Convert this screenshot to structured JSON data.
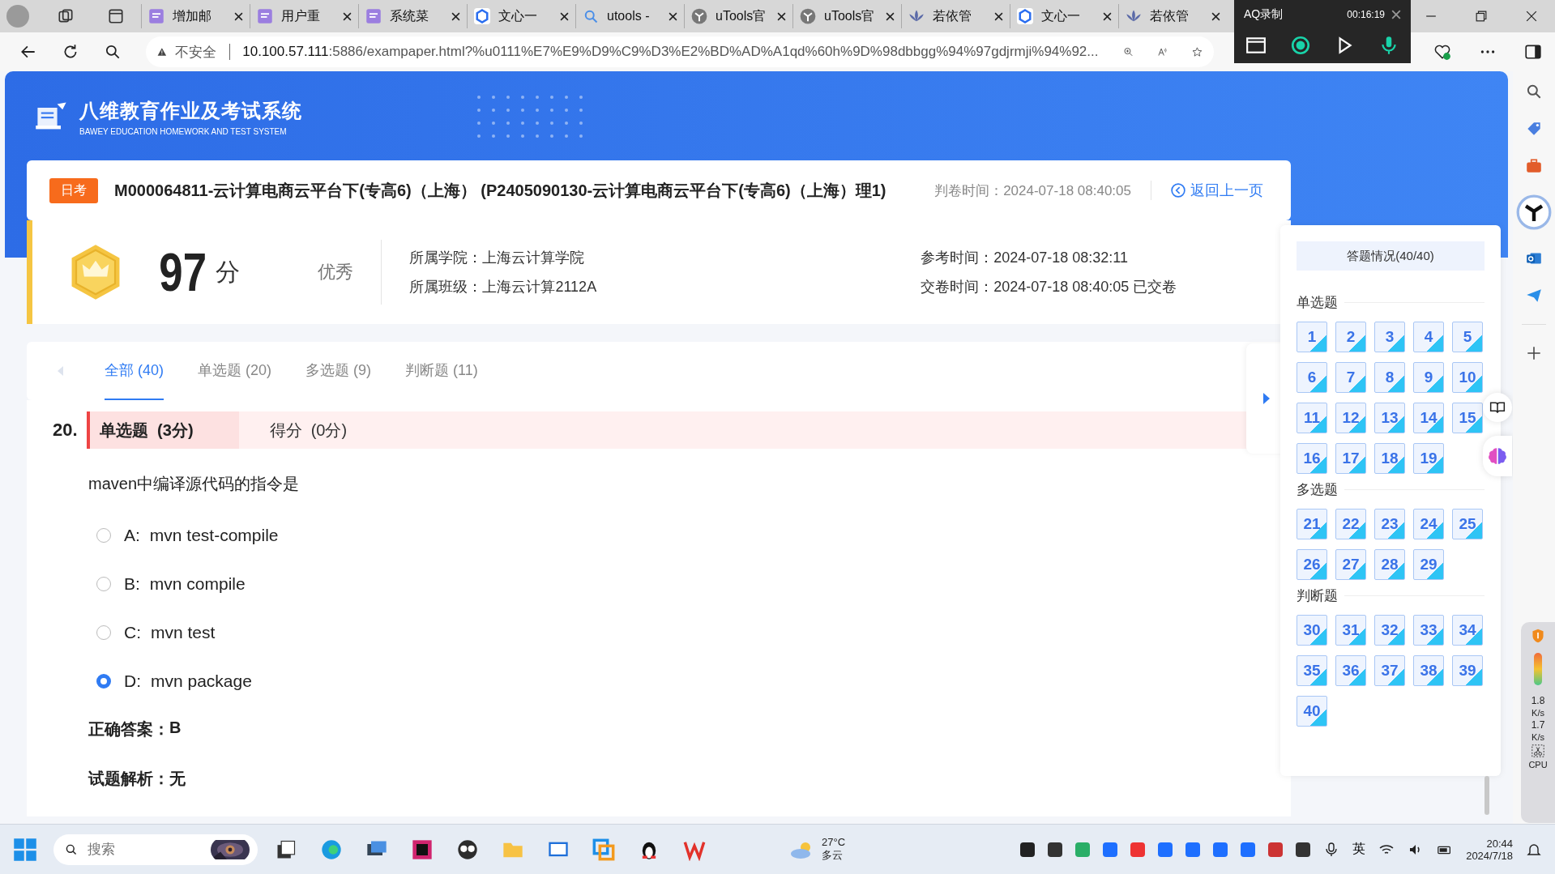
{
  "browser": {
    "tabs": [
      {
        "kind": "doc",
        "title": "增加邮"
      },
      {
        "kind": "doc",
        "title": "用户重"
      },
      {
        "kind": "doc",
        "title": "系统菜"
      },
      {
        "kind": "cube",
        "title": "文心一"
      },
      {
        "kind": "search",
        "title": "utools -"
      },
      {
        "kind": "utools",
        "title": "uTools官"
      },
      {
        "kind": "utools",
        "title": "uTools官"
      },
      {
        "kind": "leaf",
        "title": "若依管"
      },
      {
        "kind": "cube",
        "title": "文心一"
      },
      {
        "kind": "leaf",
        "title": "若依管"
      }
    ],
    "warning": "不安全",
    "url_host": "10.100.57.111",
    "url_rest": ":5886/exampaper.html?%u0111%E7%E9%D9%C9%D3%E2%BD%AD%A1qd%60h%9D%98dbbgg%94%97gdjrmji%94%92..."
  },
  "recorder": {
    "title": "AQ录制",
    "time": "00:16:19"
  },
  "site": {
    "title": "八维教育作业及考试系统",
    "subtitle": "BAWEY EDUCATION HOMEWORK AND TEST SYSTEM"
  },
  "exam": {
    "badge": "日考",
    "title": "M000064811-云计算电商云平台下(专高6)（上海） (P2405090130-云计算电商云平台下(专高6)（上海）理1)",
    "grading_time": "判卷时间：2024-07-18 08:40:05",
    "back": "返回上一页"
  },
  "result": {
    "score": "97",
    "unit": "分",
    "grade": "优秀",
    "college": "所属学院：上海云计算学院",
    "class": "所属班级：上海云计算2112A",
    "exam_time": "参考时间：2024-07-18 08:32:11",
    "submit_time": "交卷时间：2024-07-18 08:40:05 已交卷"
  },
  "filter_tabs": [
    {
      "label": "全部 (40)",
      "selected": true
    },
    {
      "label": "单选题 (20)",
      "selected": false
    },
    {
      "label": "多选题 (9)",
      "selected": false
    },
    {
      "label": "判断题 (11)",
      "selected": false
    }
  ],
  "question": {
    "number": "20.",
    "type": "单选题  (3分)",
    "score": "得分  (0分)",
    "text": "maven中编译源代码的指令是",
    "options": [
      {
        "letter": "A:",
        "text": "mvn test-compile",
        "selected": false
      },
      {
        "letter": "B:",
        "text": "mvn compile",
        "selected": false
      },
      {
        "letter": "C:",
        "text": "mvn test",
        "selected": false
      },
      {
        "letter": "D:",
        "text": "mvn package",
        "selected": true
      }
    ],
    "answer_label": "正确答案：",
    "answer": "B",
    "analysis_label": "试题解析：",
    "analysis": "无"
  },
  "panel": {
    "title": "答题情况(40/40)",
    "sections": [
      {
        "name": "单选题",
        "items": [
          "1",
          "2",
          "3",
          "4",
          "5",
          "6",
          "7",
          "8",
          "9",
          "10",
          "11",
          "12",
          "13",
          "14",
          "15",
          "16",
          "17",
          "18",
          "19"
        ]
      },
      {
        "name": "多选题",
        "items": [
          "21",
          "22",
          "23",
          "24",
          "25",
          "26",
          "27",
          "28",
          "29"
        ]
      },
      {
        "name": "判断题",
        "items": [
          "30",
          "31",
          "32",
          "33",
          "34",
          "35",
          "36",
          "37",
          "38",
          "39",
          "40"
        ]
      }
    ]
  },
  "monitor": {
    "up": "1.8",
    "up_unit": "K/s",
    "down": "1.7",
    "down_unit": "K/s",
    "cpu": "CPU"
  },
  "taskbar": {
    "search_placeholder": "搜索",
    "temperature": "27°C",
    "weather": "多云",
    "ime": "英",
    "time": "20:44",
    "date": "2024/7/18"
  }
}
